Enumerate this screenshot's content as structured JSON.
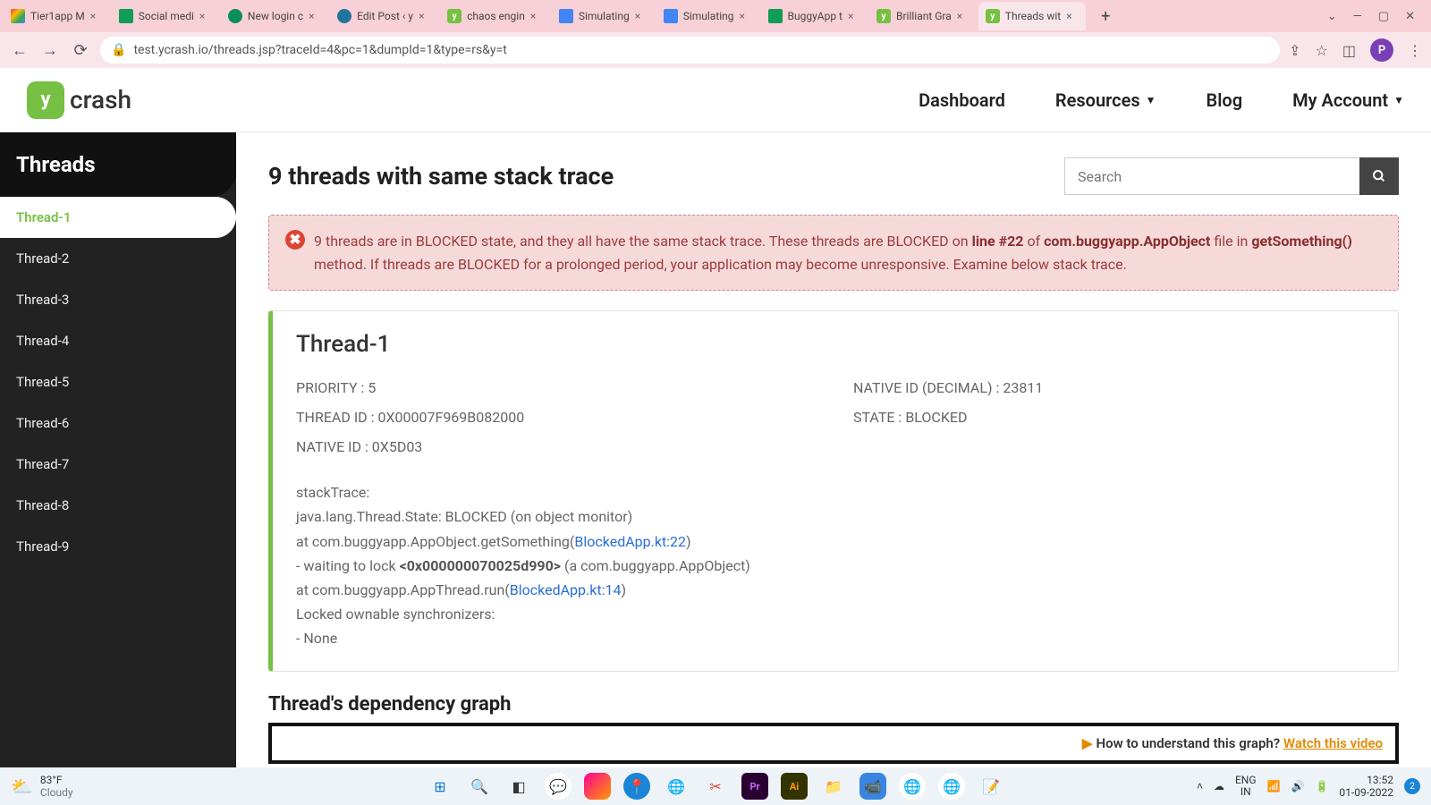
{
  "browser": {
    "tabs": [
      {
        "title": "Tier1app M"
      },
      {
        "title": "Social medi"
      },
      {
        "title": "New login c"
      },
      {
        "title": "Edit Post ‹ y"
      },
      {
        "title": "chaos engin"
      },
      {
        "title": "Simulating"
      },
      {
        "title": "Simulating"
      },
      {
        "title": "BuggyApp t"
      },
      {
        "title": "Brilliant Gra"
      },
      {
        "title": "Threads wit"
      }
    ],
    "url": "test.ycrash.io/threads.jsp?traceId=4&pc=1&dumpId=1&type=rs&y=t",
    "profile_initial": "P"
  },
  "header": {
    "logo_letter": "y",
    "logo_text": "crash",
    "nav": [
      "Dashboard",
      "Resources",
      "Blog",
      "My Account"
    ]
  },
  "sidebar": {
    "title": "Threads",
    "items": [
      "Thread-1",
      "Thread-2",
      "Thread-3",
      "Thread-4",
      "Thread-5",
      "Thread-6",
      "Thread-7",
      "Thread-8",
      "Thread-9"
    ]
  },
  "page": {
    "title": "9 threads with same stack trace",
    "search_placeholder": "Search"
  },
  "alert": {
    "pre": "9 threads are in BLOCKED state, and they all have the same stack trace. These threads are BLOCKED on ",
    "line": "line #22",
    "of": " of ",
    "cls": "com.buggyapp.AppObject",
    "file": " file in ",
    "method": "getSomething()",
    "post": " method. If threads are BLOCKED for a prolonged period, your application may become unresponsive. Examine below stack trace."
  },
  "thread": {
    "name": "Thread-1",
    "props": {
      "priority": "PRIORITY : 5",
      "native_dec": "NATIVE ID (DECIMAL) : 23811",
      "thread_id": "THREAD ID : 0X00007F969B082000",
      "state": "STATE : BLOCKED",
      "native_id": "NATIVE ID : 0X5D03"
    },
    "stack": {
      "l1": "stackTrace:",
      "l2": "java.lang.Thread.State: BLOCKED (on object monitor)",
      "l3a": "at com.buggyapp.AppObject.getSomething(",
      "l3b": "BlockedApp.kt:22",
      "l3c": ")",
      "l4a": "- waiting to lock ",
      "l4b": "<0x000000070025d990>",
      "l4c": " (a com.buggyapp.AppObject)",
      "l5a": "at com.buggyapp.AppThread.run(",
      "l5b": "BlockedApp.kt:14",
      "l5c": ")",
      "l6": "Locked ownable synchronizers:",
      "l7": "- None"
    }
  },
  "dep": {
    "title": "Thread's dependency graph",
    "help": "How to understand this graph? ",
    "link": "Watch this video"
  },
  "taskbar": {
    "temp": "83°F",
    "cond": "Cloudy",
    "lang1": "ENG",
    "lang2": "IN",
    "time": "13:52",
    "date": "01-09-2022",
    "notif": "2"
  }
}
